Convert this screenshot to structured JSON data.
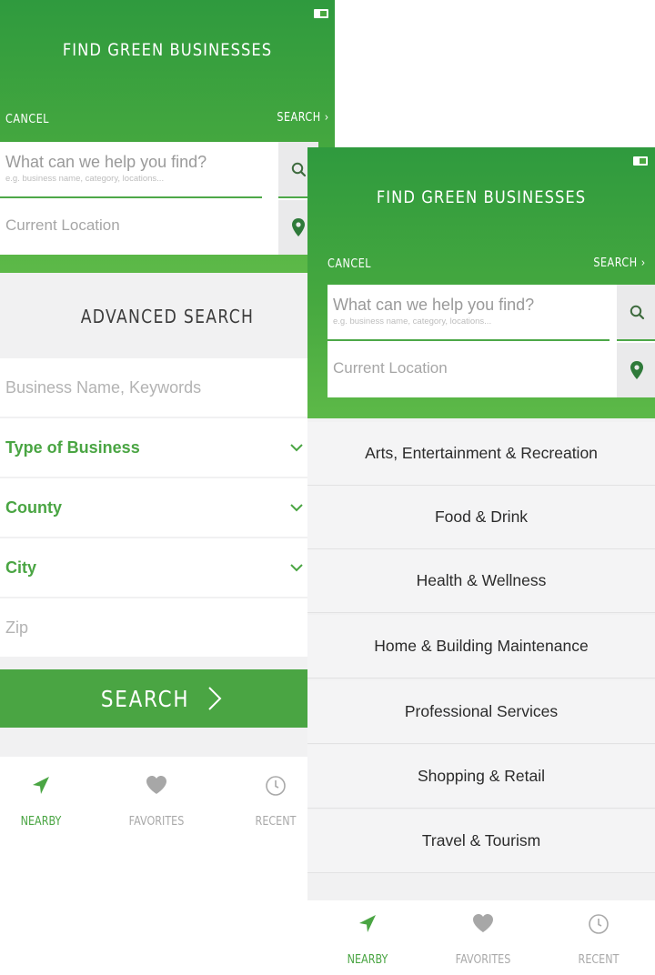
{
  "colors": {
    "brand_green": "#4aa543",
    "header_gradient_top": "#2f9a3e",
    "header_gradient_bottom": "#5db948"
  },
  "screens": {
    "advanced": {
      "header": {
        "title": "FIND GREEN BUSINESSES",
        "cancel_label": "CANCEL",
        "search_label": "SEARCH ›"
      },
      "search": {
        "main_placeholder": "What can we help you find?",
        "sub_placeholder": "e.g. business name, category, locations...",
        "location_placeholder": "Current Location"
      },
      "advanced": {
        "title": "ADVANCED SEARCH",
        "keywords_placeholder": "Business Name, Keywords",
        "type_label": "Type of Business",
        "county_label": "County",
        "city_label": "City",
        "zip_placeholder": "Zip",
        "search_button": "SEARCH"
      },
      "tabbar": {
        "nearby": "NEARBY",
        "favorites": "FAVORITES",
        "recent": "RECENT"
      }
    },
    "categories": {
      "header": {
        "title": "FIND GREEN BUSINESSES",
        "cancel_label": "CANCEL",
        "search_label": "SEARCH ›"
      },
      "search": {
        "main_placeholder": "What can we help you find?",
        "sub_placeholder": "e.g. business name, category, locations...",
        "location_placeholder": "Current Location"
      },
      "categories": [
        "Arts, Entertainment & Recreation",
        "Food & Drink",
        "Health & Wellness",
        "Home & Building Maintenance",
        "Professional Services",
        "Shopping & Retail",
        "Travel & Tourism"
      ],
      "tabbar": {
        "nearby": "NEARBY",
        "favorites": "FAVORITES",
        "recent": "RECENT"
      }
    }
  },
  "icons": {
    "search": "search-icon",
    "location": "map-pin-icon",
    "chevron": "chevron-down-icon",
    "nearby": "location-arrow-icon",
    "favorites": "heart-icon",
    "recent": "clock-icon",
    "battery": "battery-icon"
  }
}
